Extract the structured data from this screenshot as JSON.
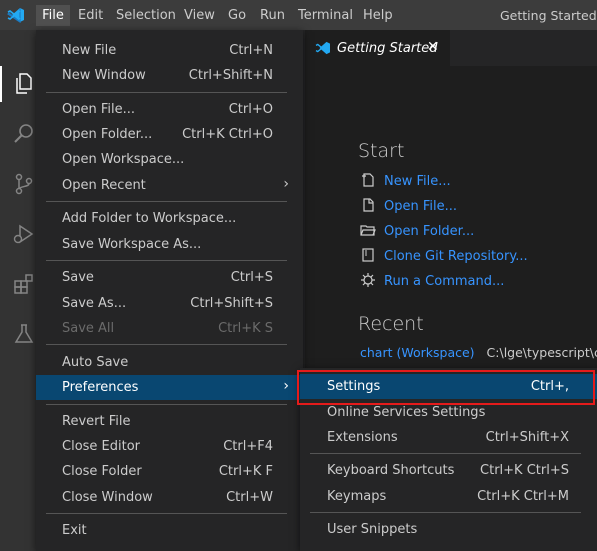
{
  "menubar": {
    "items": [
      "File",
      "Edit",
      "Selection",
      "View",
      "Go",
      "Run",
      "Terminal",
      "Help"
    ],
    "title": "Getting Started - E"
  },
  "activity": {
    "icons": [
      "files-icon",
      "search-icon",
      "source-control-icon",
      "run-debug-icon",
      "extensions-icon",
      "test-flask-icon"
    ]
  },
  "tab": {
    "label": "Getting Started",
    "close": "✕"
  },
  "start": {
    "heading": "Start",
    "links": [
      "New File...",
      "Open File...",
      "Open Folder...",
      "Clone Git Repository...",
      "Run a Command..."
    ]
  },
  "recent": {
    "heading": "Recent",
    "name": "chart (Workspace)",
    "path": "C:\\lge\\typescript\\cha"
  },
  "file_menu": {
    "groups": [
      [
        {
          "label": "New File",
          "shortcut": "Ctrl+N"
        },
        {
          "label": "New Window",
          "shortcut": "Ctrl+Shift+N"
        }
      ],
      [
        {
          "label": "Open File...",
          "shortcut": "Ctrl+O"
        },
        {
          "label": "Open Folder...",
          "shortcut": "Ctrl+K Ctrl+O"
        },
        {
          "label": "Open Workspace...",
          "shortcut": ""
        },
        {
          "label": "Open Recent",
          "shortcut": ""
        }
      ],
      [
        {
          "label": "Add Folder to Workspace...",
          "shortcut": ""
        },
        {
          "label": "Save Workspace As...",
          "shortcut": ""
        }
      ],
      [
        {
          "label": "Save",
          "shortcut": "Ctrl+S"
        },
        {
          "label": "Save As...",
          "shortcut": "Ctrl+Shift+S"
        },
        {
          "label": "Save All",
          "shortcut": "Ctrl+K S"
        }
      ],
      [
        {
          "label": "Auto Save",
          "shortcut": ""
        },
        {
          "label": "Preferences",
          "shortcut": ""
        }
      ],
      [
        {
          "label": "Revert File",
          "shortcut": ""
        },
        {
          "label": "Close Editor",
          "shortcut": "Ctrl+F4"
        },
        {
          "label": "Close Folder",
          "shortcut": "Ctrl+K F"
        },
        {
          "label": "Close Window",
          "shortcut": "Ctrl+W"
        }
      ],
      [
        {
          "label": "Exit",
          "shortcut": ""
        }
      ]
    ]
  },
  "pref_menu": {
    "items": [
      {
        "label": "Settings",
        "shortcut": "Ctrl+,"
      },
      {
        "label": "Online Services Settings",
        "shortcut": ""
      },
      {
        "label": "Extensions",
        "shortcut": "Ctrl+Shift+X"
      },
      {
        "label": "Keyboard Shortcuts",
        "shortcut": "Ctrl+K Ctrl+S"
      },
      {
        "label": "Keymaps",
        "shortcut": "Ctrl+K Ctrl+M"
      },
      {
        "label": "User Snippets",
        "shortcut": ""
      }
    ]
  },
  "colors": {
    "highlight": "#094771",
    "link": "#3794ff",
    "annotation": "#e51b1b",
    "vscode_blue": "#23a9f2"
  },
  "arrow_glyph": "›"
}
